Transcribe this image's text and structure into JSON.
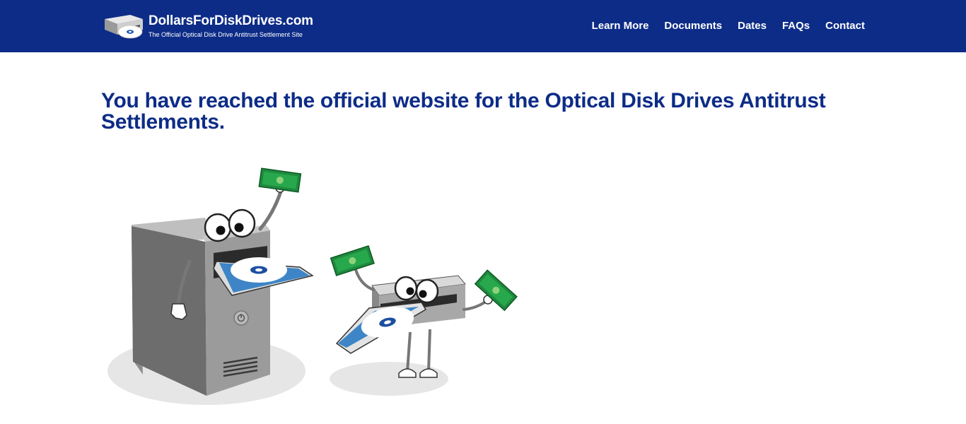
{
  "header": {
    "site_name": "DollarsForDiskDrives.com",
    "tagline": "The Official Optical Disk Drive Antitrust Settlement Site",
    "logo_icon": "disk-drive-logo-icon",
    "colors": {
      "background": "#0d2c87",
      "text": "#ffffff"
    }
  },
  "nav": {
    "items": [
      {
        "label": "Learn More"
      },
      {
        "label": "Documents"
      },
      {
        "label": "Dates"
      },
      {
        "label": "FAQs"
      },
      {
        "label": "Contact"
      }
    ]
  },
  "main": {
    "headline": "You have reached the official website for the Optical Disk Drives Antitrust Settlements.",
    "headline_color": "#0d2c87",
    "illustration": "cartoon-computer-and-disk-drive-holding-money-icon"
  }
}
